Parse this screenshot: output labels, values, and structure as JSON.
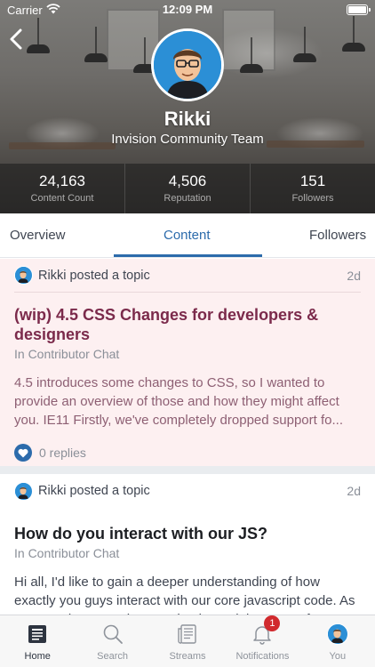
{
  "status_bar": {
    "carrier": "Carrier",
    "time": "12:09 PM",
    "battery_level_percent": 100
  },
  "profile": {
    "name": "Rikki",
    "team": "Invision Community Team",
    "stats": [
      {
        "value": "24,163",
        "label": "Content Count"
      },
      {
        "value": "4,506",
        "label": "Reputation"
      },
      {
        "value": "151",
        "label": "Followers"
      }
    ]
  },
  "tabs": {
    "overview": "Overview",
    "content": "Content",
    "followers": "Followers",
    "active": "Content"
  },
  "feed": {
    "items": [
      {
        "action": "Rikki posted a topic",
        "time": "2d",
        "title": "(wip) 4.5 CSS Changes for developers & designers",
        "forum": "In Contributor Chat",
        "excerpt": "4.5 introduces some changes to CSS, so I wanted to provide an overview of those and how they might affect you. IE11 Firstly, we've completely dropped support fo...",
        "replies": "0 replies"
      },
      {
        "action": "Rikki posted a topic",
        "time": "2d",
        "title": "How do you interact with our JS?",
        "forum": "In Contributor Chat",
        "excerpt": "Hi all, I'd like to gain a deeper understanding of how exactly you guys interact with our core javascript code. As you may know, we have a simple module system fo..."
      }
    ]
  },
  "tabbar": {
    "home": "Home",
    "search": "Search",
    "streams": "Streams",
    "notifications": "Notifications",
    "notifications_badge": "1",
    "you": "You",
    "active": "Home"
  },
  "colors": {
    "accent": "#2c6bab",
    "highlight_title": "#7b2a4b",
    "highlight_background": "#fdf0f1",
    "badge": "#d12a2e"
  },
  "icons": [
    "back-chevron-icon",
    "wifi-icon",
    "battery-icon",
    "heart-icon",
    "home-icon",
    "search-icon",
    "streams-icon",
    "bell-icon",
    "avatar-icon"
  ]
}
